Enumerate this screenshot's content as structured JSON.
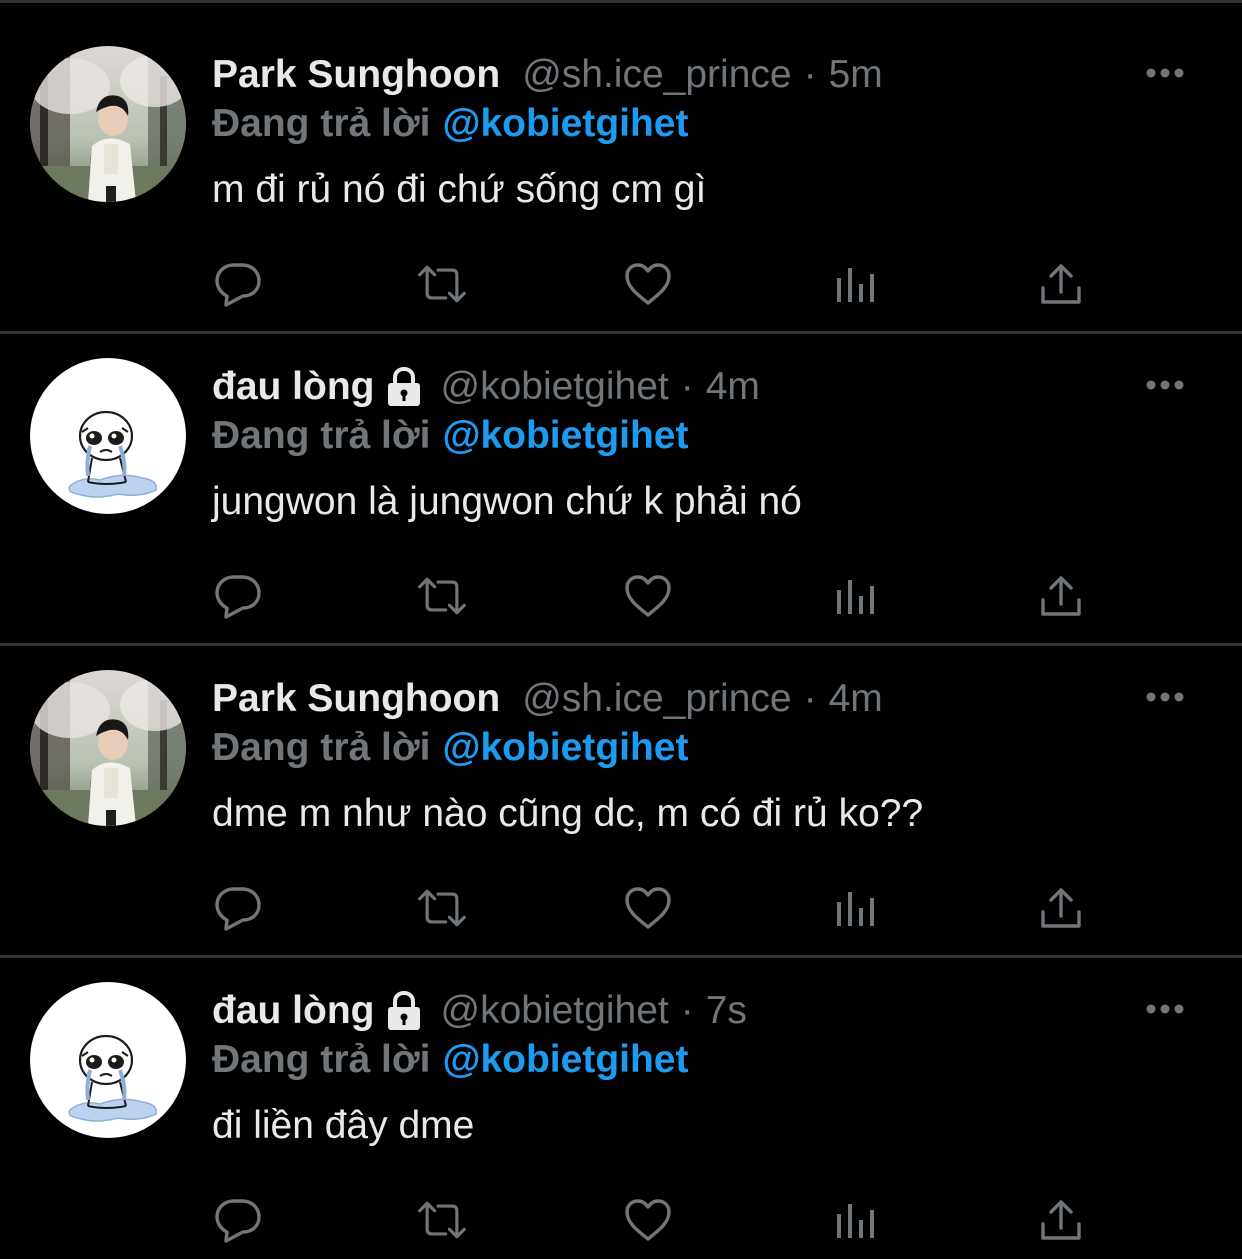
{
  "tweets": [
    {
      "display_name": "Park Sunghoon",
      "handle": "@sh.ice_prince",
      "separator": "·",
      "time": "5m",
      "locked": false,
      "avatar": "photo-avatar",
      "reply_prefix": "Đang trả lời",
      "reply_target": "@kobietgihet",
      "text": "m đi rủ nó đi chứ sống cm gì"
    },
    {
      "display_name": "đau lòng",
      "handle": "@kobietgihet",
      "separator": "·",
      "time": "4m",
      "locked": true,
      "avatar": "crying-doodle-avatar",
      "reply_prefix": "Đang trả lời",
      "reply_target": "@kobietgihet",
      "text": "jungwon là jungwon chứ k phải nó"
    },
    {
      "display_name": "Park Sunghoon",
      "handle": "@sh.ice_prince",
      "separator": "·",
      "time": "4m",
      "locked": false,
      "avatar": "photo-avatar",
      "reply_prefix": "Đang trả lời",
      "reply_target": "@kobietgihet",
      "text": "dme m như nào cũng dc, m có đi rủ ko??"
    },
    {
      "display_name": "đau lòng",
      "handle": "@kobietgihet",
      "separator": "·",
      "time": "7s",
      "locked": true,
      "avatar": "crying-doodle-avatar",
      "reply_prefix": "Đang trả lời",
      "reply_target": "@kobietgihet",
      "text": "đi liền đây dme"
    }
  ],
  "action_icons": [
    "reply-icon",
    "retweet-icon",
    "like-icon",
    "views-icon",
    "share-icon"
  ],
  "colors": {
    "background": "#000000",
    "divider": "#2f3336",
    "primary_text": "#e7e9ea",
    "secondary_text": "#71767b",
    "accent": "#1d9bf0"
  }
}
